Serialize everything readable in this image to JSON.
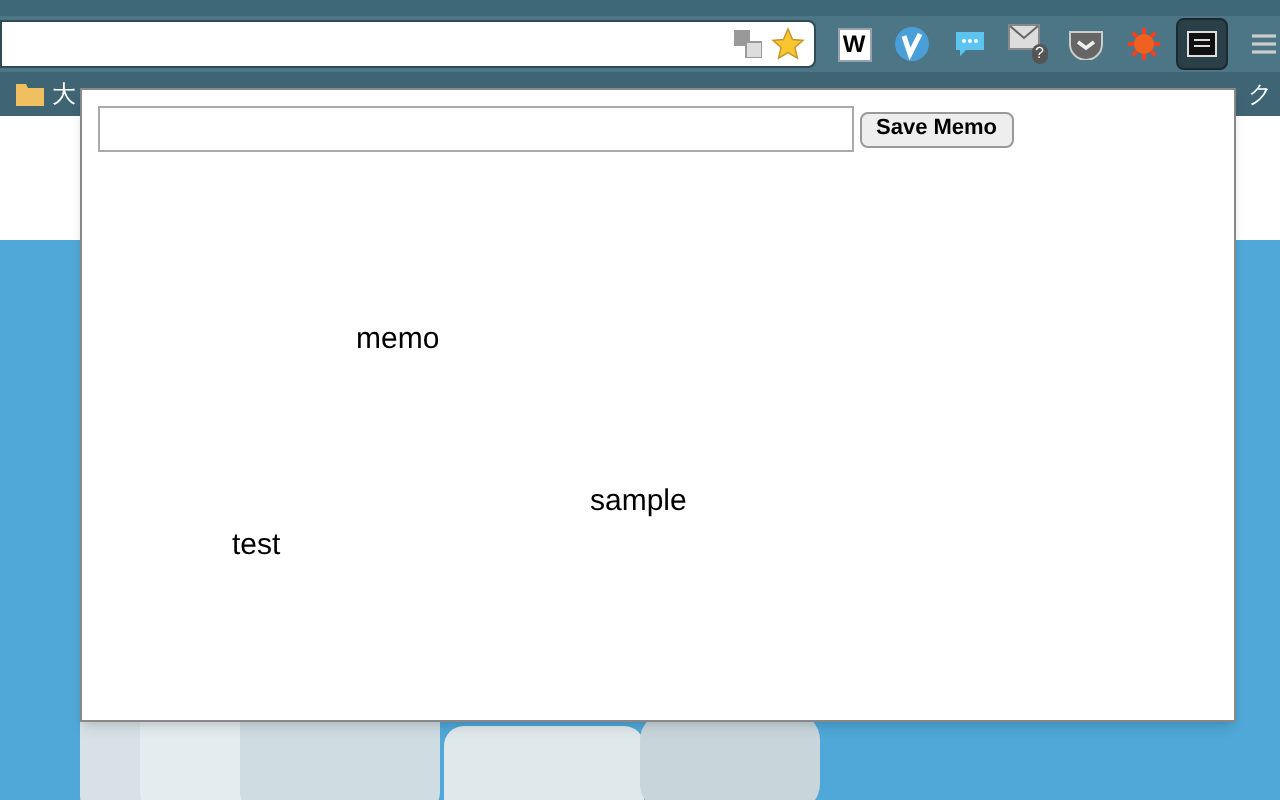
{
  "toolbar": {
    "extensions": [
      {
        "kind": "w",
        "label": "W",
        "selected": false
      },
      {
        "kind": "v",
        "selected": false
      },
      {
        "kind": "chat",
        "selected": false
      },
      {
        "kind": "mail",
        "label": "?",
        "selected": false
      },
      {
        "kind": "pocket",
        "selected": false
      },
      {
        "kind": "sun",
        "selected": false
      },
      {
        "kind": "memo",
        "selected": true
      }
    ]
  },
  "bookmarks": [
    {
      "label": "大"
    },
    {
      "label": "ク"
    }
  ],
  "popup": {
    "save_button": "Save Memo",
    "memos": [
      {
        "text": "memo"
      },
      {
        "text": "sample"
      },
      {
        "text": "test"
      }
    ]
  }
}
